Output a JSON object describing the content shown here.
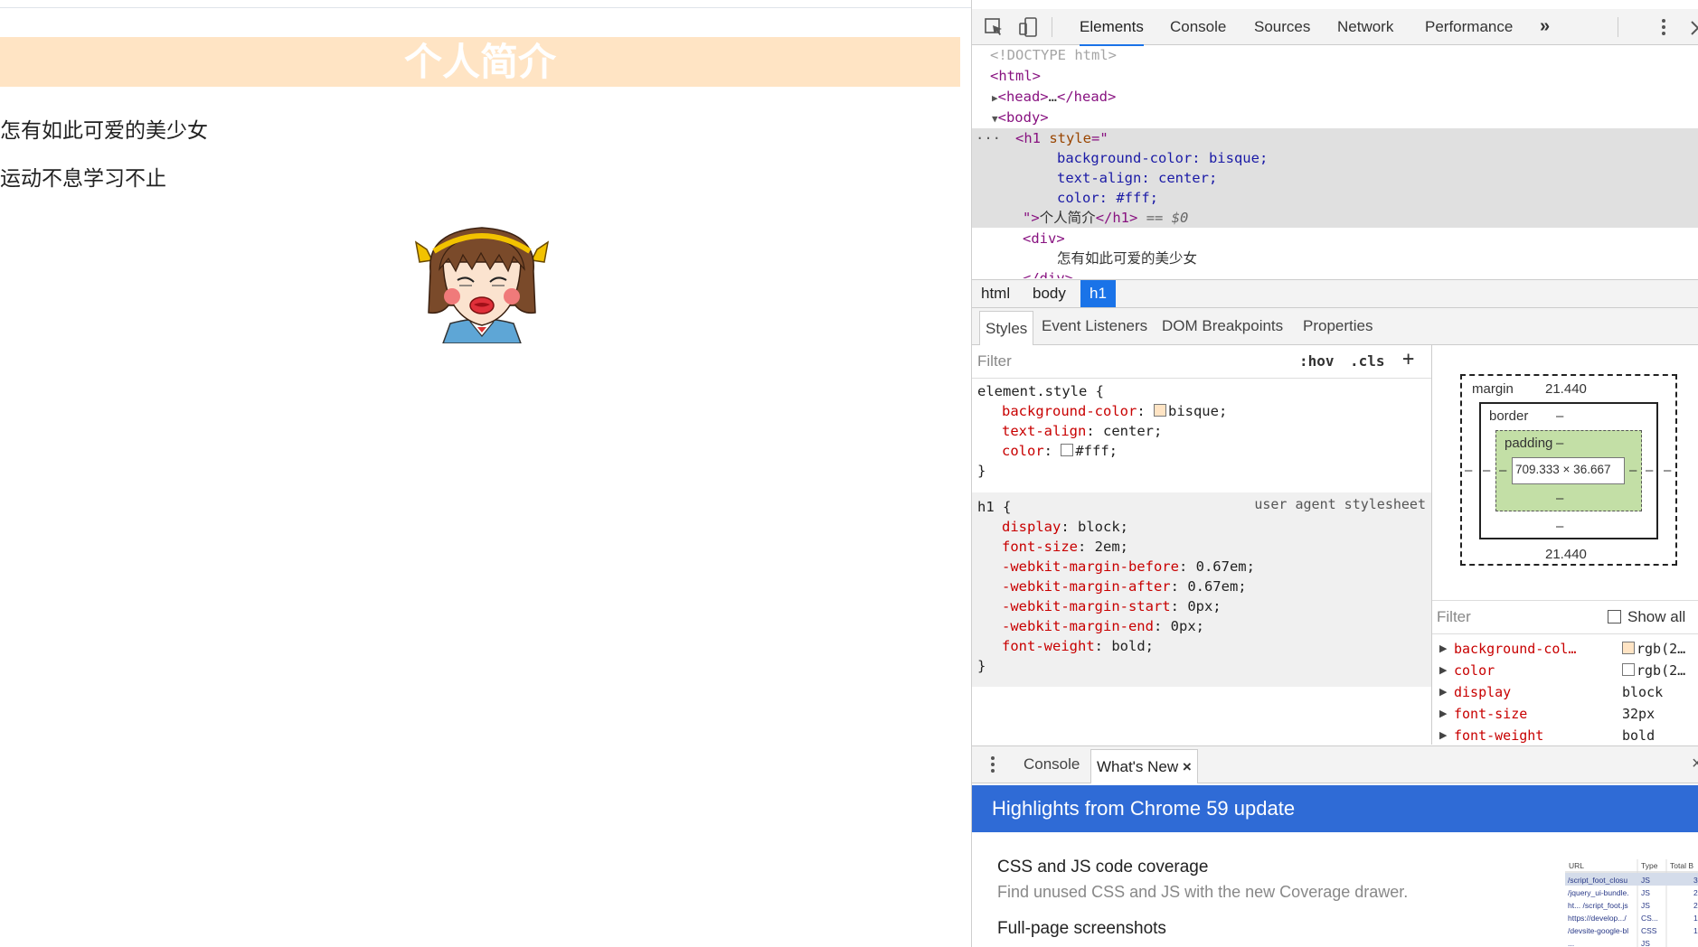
{
  "page": {
    "heading": "个人简介",
    "line1": "怎有如此可爱的美少女",
    "line2": "运动不息学习不止"
  },
  "toolbar": {
    "tabs": [
      "Elements",
      "Console",
      "Sources",
      "Network",
      "Performance"
    ],
    "more": "»"
  },
  "dom": {
    "doctype": "<!DOCTYPE html>",
    "html_open": "<html>",
    "head_tag": "head",
    "head_ellipsis": "…",
    "body_open": "<body>",
    "h1_attr": "style",
    "style_line1": "background-color: bisque;",
    "style_line2": "text-align: center;",
    "style_line3": "color: #fff;",
    "h1_text": "个人简介",
    "h1_eq": "== $0",
    "div_open": "<div>",
    "div_text": "怎有如此可爱的美少女",
    "div_close_partial": "</div>"
  },
  "breadcrumbs": [
    "html",
    "body",
    "h1"
  ],
  "subtabs": [
    "Styles",
    "Event Listeners",
    "DOM Breakpoints",
    "Properties"
  ],
  "styles": {
    "filter_placeholder": "Filter",
    "hov": ":hov",
    "cls": ".cls",
    "add": "+",
    "element_style": {
      "selector": "element.style {",
      "props": [
        {
          "name": "background-color",
          "value": "bisque;",
          "swatch": "#ffe4c4"
        },
        {
          "name": "text-align",
          "value": "center;"
        },
        {
          "name": "color",
          "value": "#fff;",
          "swatch": "#ffffff"
        }
      ],
      "close": "}"
    },
    "h1_rule": {
      "selector": "h1 {",
      "source": "user agent stylesheet",
      "props": [
        {
          "name": "display",
          "value": "block;"
        },
        {
          "name": "font-size",
          "value": "2em;"
        },
        {
          "name": "-webkit-margin-before",
          "value": "0.67em;"
        },
        {
          "name": "-webkit-margin-after",
          "value": "0.67em;"
        },
        {
          "name": "-webkit-margin-start",
          "value": "0px;"
        },
        {
          "name": "-webkit-margin-end",
          "value": "0px;"
        },
        {
          "name": "font-weight",
          "value": "bold;"
        }
      ],
      "close": "}"
    }
  },
  "boxmodel": {
    "margin_label": "margin",
    "margin_top": "21.440",
    "margin_bottom": "21.440",
    "border_label": "border",
    "border_value": "–",
    "padding_label": "padding",
    "padding_value": "–",
    "content": "709.333 × 36.667",
    "dash": "–"
  },
  "computed": {
    "filter_placeholder": "Filter",
    "show_all": "Show all",
    "rows": [
      {
        "name": "background-col…",
        "value": "rgb(2…",
        "swatch": "#ffe4c4"
      },
      {
        "name": "color",
        "value": "rgb(2…",
        "swatch": "#ffffff"
      },
      {
        "name": "display",
        "value": "block"
      },
      {
        "name": "font-size",
        "value": "32px"
      },
      {
        "name": "font-weight",
        "value": "bold"
      }
    ]
  },
  "drawer": {
    "tabs": [
      "Console",
      "What's New"
    ],
    "close_glyph": "×"
  },
  "whatsnew": {
    "header": "Highlights from Chrome 59 update",
    "item1_title": "CSS and JS code coverage",
    "item1_desc": "Find unused CSS and JS with the new Coverage drawer.",
    "item2_title": "Full-page screenshots"
  },
  "thumb": {
    "headers": [
      "URL",
      "Type",
      "Total B"
    ],
    "rows": [
      {
        "url": "/script_foot_closu",
        "type": "JS",
        "total": "3"
      },
      {
        "url": "/jquery_ui-bundle.",
        "type": "JS",
        "total": "2"
      },
      {
        "url": "ht... /script_foot.js",
        "type": "JS",
        "total": "2"
      },
      {
        "url": "https://develop.../",
        "type": "CS...",
        "total": "1"
      },
      {
        "url": "/devsite-google-bl",
        "type": "CSS",
        "total": "1"
      },
      {
        "url": "...",
        "type": "JS",
        "total": ""
      }
    ]
  },
  "colors": {
    "heading_bg": "#ffe4c4",
    "accent": "#1a73e8",
    "whatsnew_bg": "#2f6bd6"
  },
  "icons": [
    "inspect-icon",
    "device-toggle-icon",
    "more-tabs-icon",
    "kebab-menu-icon",
    "close-devtools-icon",
    "drawer-menu-icon",
    "close-drawer-icon"
  ]
}
